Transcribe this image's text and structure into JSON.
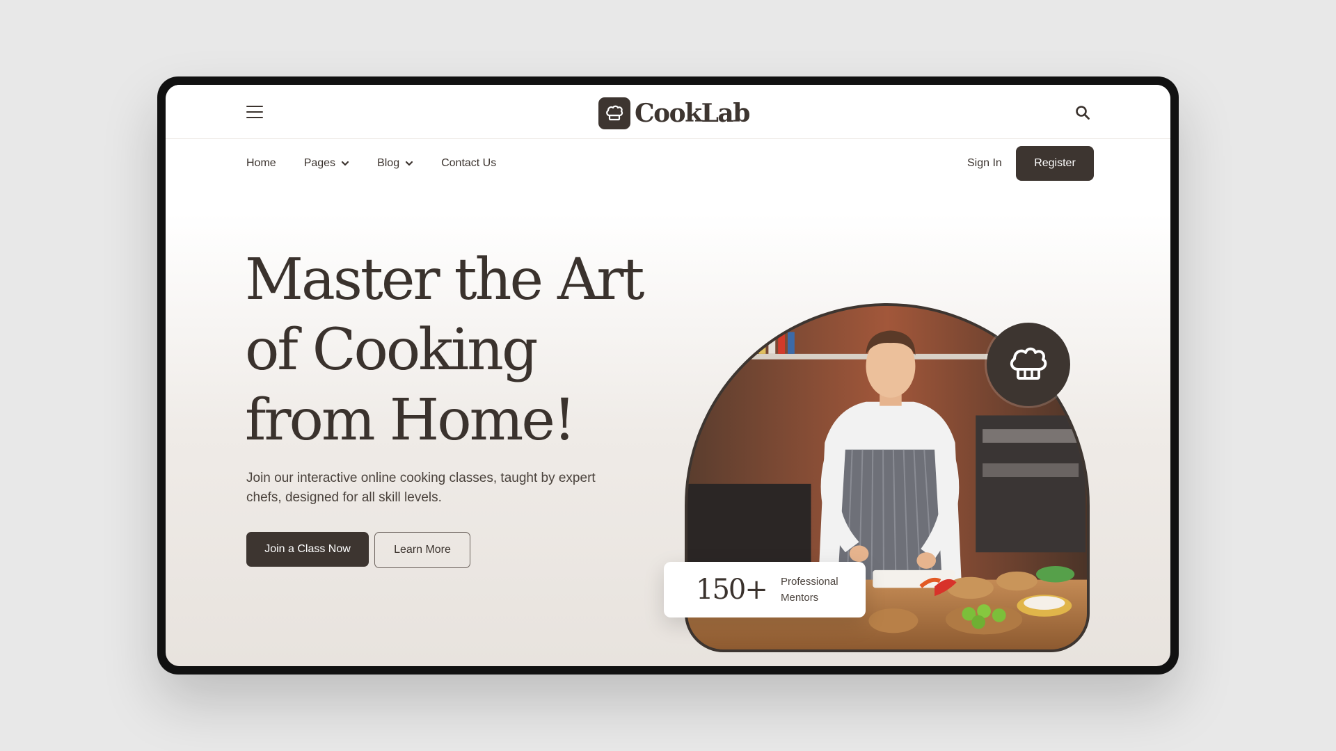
{
  "brand": {
    "name": "CookLab",
    "logo_icon": "chef-hat-icon"
  },
  "header": {
    "menu_icon": "hamburger-menu-icon",
    "search_icon": "search-icon"
  },
  "nav": {
    "items": [
      {
        "label": "Home",
        "has_dropdown": false
      },
      {
        "label": "Pages",
        "has_dropdown": true
      },
      {
        "label": "Blog",
        "has_dropdown": true
      },
      {
        "label": "Contact Us",
        "has_dropdown": false
      }
    ],
    "sign_in": "Sign In",
    "register": "Register"
  },
  "hero": {
    "title_lines": [
      "Master the Art",
      "of Cooking",
      "from Home!"
    ],
    "subtitle": "Join our interactive online cooking classes, taught by expert chefs, designed for all skill levels.",
    "primary_cta": "Join a Class Now",
    "secondary_cta": "Learn More",
    "badge_icon": "chef-hat-icon",
    "stat": {
      "value": "150+",
      "label_line1": "Professional",
      "label_line2": "Mentors"
    }
  },
  "colors": {
    "brand_dark": "#3d3530",
    "background": "#e8e8e8",
    "text": "#3a322d"
  }
}
